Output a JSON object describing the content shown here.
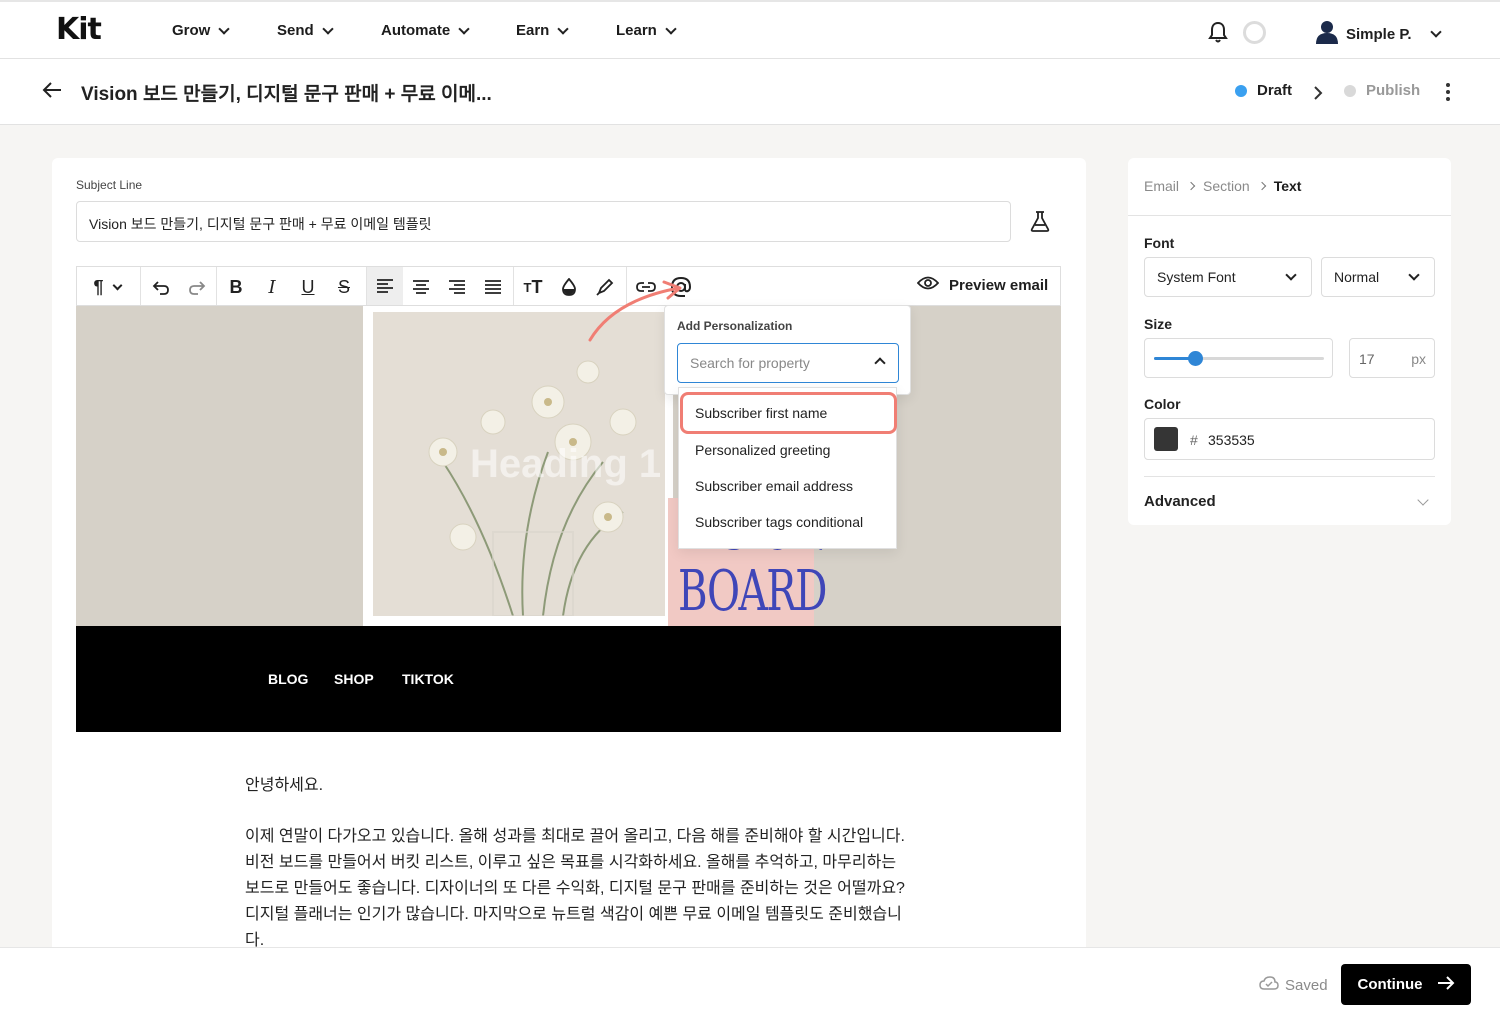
{
  "app": {
    "logo": "Kit",
    "nav": [
      {
        "label": "Grow"
      },
      {
        "label": "Send"
      },
      {
        "label": "Automate"
      },
      {
        "label": "Earn"
      },
      {
        "label": "Learn"
      }
    ],
    "user_name": "Simple P."
  },
  "titlebar": {
    "title": "Vision 보드 만들기, 디지털 문구 판매 + 무료 이메...",
    "status_draft": "Draft",
    "status_publish": "Publish",
    "colors": {
      "draft": "#3aa0f0",
      "publish": "#d9d9d9"
    }
  },
  "editor": {
    "subject_label": "Subject Line",
    "subject_value": "Vision 보드 만들기, 디지털 문구 판매 + 무료 이메일 템플릿",
    "preview_label": "Preview email",
    "heading_placeholder": "Heading 1",
    "vision_board_text_line1": "VISION",
    "vision_board_text_line2": "BOARD",
    "nav_links": [
      "BLOG",
      "SHOP",
      "TIKTOK"
    ],
    "body_greeting": "안녕하세요.",
    "body_paragraph": "이제 연말이 다가오고 있습니다. 올해 성과를 최대로 끌어 올리고, 다음 해를 준비해야 할 시간입니다. 비전 보드를 만들어서 버킷 리스트, 이루고 싶은 목표를 시각화하세요. 올해를 추억하고, 마무리하는 보드로 만들어도 좋습니다. 디자이너의 또 다른 수익화, 디지털 문구 판매를 준비하는 것은 어떨까요? 디지털 플래너는 인기가 많습니다. 마지막으로 뉴트럴 색감이 예쁜 무료 이메일 템플릿도 준비했습니다."
  },
  "personalization": {
    "title": "Add Personalization",
    "search_placeholder": "Search for property",
    "items": [
      "Subscriber first name",
      "Personalized greeting",
      "Subscriber email address",
      "Subscriber tags conditional"
    ],
    "highlight_color": "#f07e74"
  },
  "panel": {
    "breadcrumb": [
      "Email",
      "Section",
      "Text"
    ],
    "font_label": "Font",
    "font_family": "System Font",
    "font_weight": "Normal",
    "size_label": "Size",
    "size_value": "17",
    "size_unit": "px",
    "size_slider_fraction": 0.24,
    "color_label": "Color",
    "color_hash": "#",
    "color_value": "353535",
    "color_swatch": "#353535",
    "advanced_label": "Advanced"
  },
  "footer": {
    "saved_label": "Saved",
    "continue_label": "Continue"
  }
}
